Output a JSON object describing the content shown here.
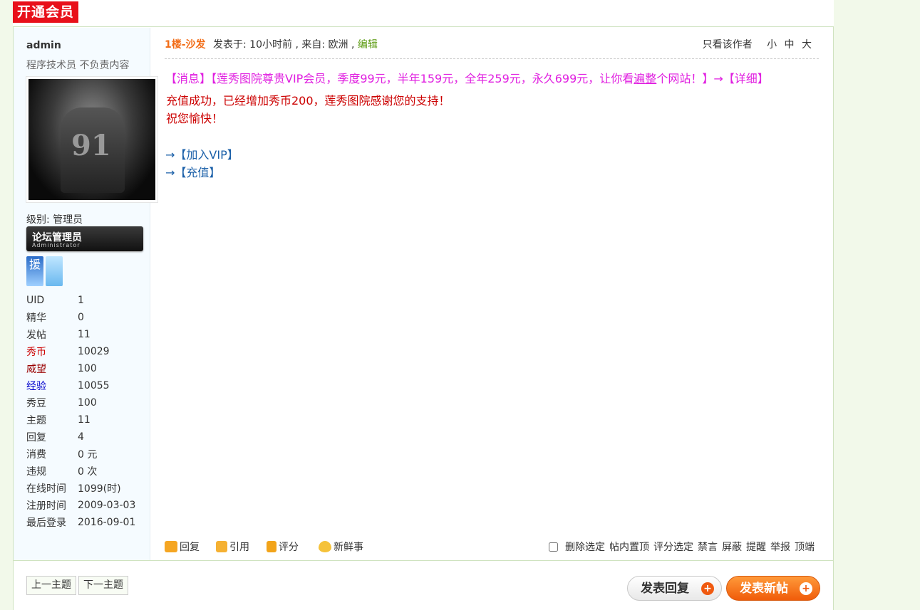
{
  "header": {
    "vip_label": "开通会员"
  },
  "user": {
    "name": "admin",
    "title": "程序技术员 不负责内容",
    "level_label": "级别: 管理员",
    "badge_title": "论坛管理员",
    "badge_sub": "Administrator",
    "medal1_text": "援",
    "stats": [
      {
        "k": "UID",
        "v": "1",
        "color": "#333333"
      },
      {
        "k": "精华",
        "v": "0",
        "color": "#333333"
      },
      {
        "k": "发帖",
        "v": "11",
        "color": "#333333"
      },
      {
        "k": "秀币",
        "v": "10029",
        "color": "#cc0000"
      },
      {
        "k": "威望",
        "v": "100",
        "color": "#990000"
      },
      {
        "k": "经验",
        "v": "10055",
        "color": "#0000cc"
      },
      {
        "k": "秀豆",
        "v": "100",
        "color": "#333333"
      },
      {
        "k": "主题",
        "v": "11",
        "color": "#333333"
      },
      {
        "k": "回复",
        "v": "4",
        "color": "#333333"
      },
      {
        "k": "消费",
        "v": "0 元",
        "color": "#333333"
      },
      {
        "k": "违规",
        "v": "0 次",
        "color": "#333333"
      },
      {
        "k": "在线时间",
        "v": "1099(时)",
        "color": "#333333"
      },
      {
        "k": "注册时间",
        "v": "2009-03-03",
        "color": "#333333"
      },
      {
        "k": "最后登录",
        "v": "2016-09-01",
        "color": "#333333"
      }
    ]
  },
  "post": {
    "floor": "1楼-沙发",
    "posted_prefix": "发表于: 10小时前 , 来自: 欧洲 ,",
    "edit": "编辑",
    "only_author": "只看该作者",
    "size_small": "小",
    "size_medium": "中",
    "size_large": "大",
    "message_a": "【消息】【莲秀图院尊贵VIP会员，季度99元，半年159元，全年259元，永久699元，让你看",
    "message_u": "遍整",
    "message_b": "个网站！】→【详细】",
    "line1": "充值成功，已经增加秀币200，莲秀图院感谢您的支持！",
    "line2": "祝您愉快！",
    "link_vip": "→【加入VIP】",
    "link_recharge": "→【充值】"
  },
  "actions": {
    "reply": "回复",
    "quote": "引用",
    "rate": "评分",
    "fresh": "新鲜事",
    "mod": [
      "删除选定",
      "帖内置顶",
      "评分选定",
      "禁言",
      "屏蔽",
      "提醒",
      "举报",
      "顶端"
    ]
  },
  "footer": {
    "prev": "上一主题",
    "next": "下一主题",
    "reply_btn": "发表回复",
    "new_btn": "发表新帖"
  }
}
